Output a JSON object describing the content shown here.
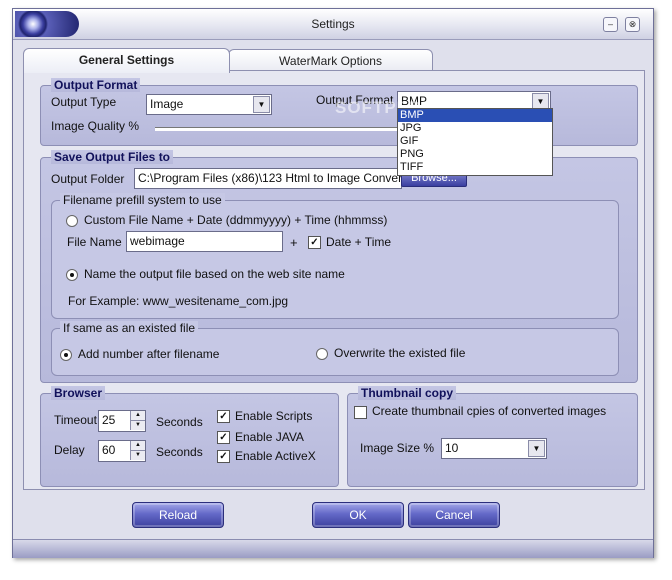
{
  "window": {
    "title": "Settings"
  },
  "tabs": [
    {
      "label": "General Settings",
      "active": true
    },
    {
      "label": "WaterMark Options",
      "active": false
    }
  ],
  "output_format": {
    "title": "Output Format",
    "type_label": "Output Type",
    "type_value": "Image",
    "format_label": "Output Format",
    "format_value": "BMP",
    "format_options": [
      "BMP",
      "JPG",
      "GIF",
      "PNG",
      "TIFF"
    ],
    "quality_label": "Image Quality %"
  },
  "watermark_text": "SOFTPEDIA",
  "save_output": {
    "title": "Save Output Files to",
    "folder_label": "Output Folder",
    "folder_value": "C:\\Program Files (x86)\\123 Html to Image Converter",
    "browse_label": "Browse..."
  },
  "filename_prefill": {
    "title": "Filename prefill system to use",
    "custom_label": "Custom File Name + Date (ddmmyyyy) + Time (hhmmss)",
    "file_name_label": "File Name",
    "file_name_value": "webimage",
    "plus": "+",
    "date_time_label": "Date + Time",
    "site_name_label": "Name the output file based on the web site name",
    "example_label": "For Example: www_wesitename_com.jpg"
  },
  "if_exists": {
    "title": "If same as an existed file",
    "add_number_label": "Add number after filename",
    "overwrite_label": "Overwrite the existed file"
  },
  "browser": {
    "title": "Browser",
    "timeout_label": "Timeout",
    "timeout_value": "25",
    "delay_label": "Delay",
    "delay_value": "60",
    "seconds_label": "Seconds",
    "scripts_label": "Enable Scripts",
    "java_label": "Enable JAVA",
    "activex_label": "Enable ActiveX"
  },
  "thumbnail": {
    "title": "Thumbnail copy",
    "create_label": "Create thumbnail cpies of converted images",
    "size_label": "Image Size %",
    "size_value": "10"
  },
  "buttons": {
    "reload": "Reload",
    "ok": "OK",
    "cancel": "Cancel"
  },
  "colors": {
    "accent": "#3c409e",
    "panel": "#bbbddd",
    "selection": "#2a4fb4"
  }
}
